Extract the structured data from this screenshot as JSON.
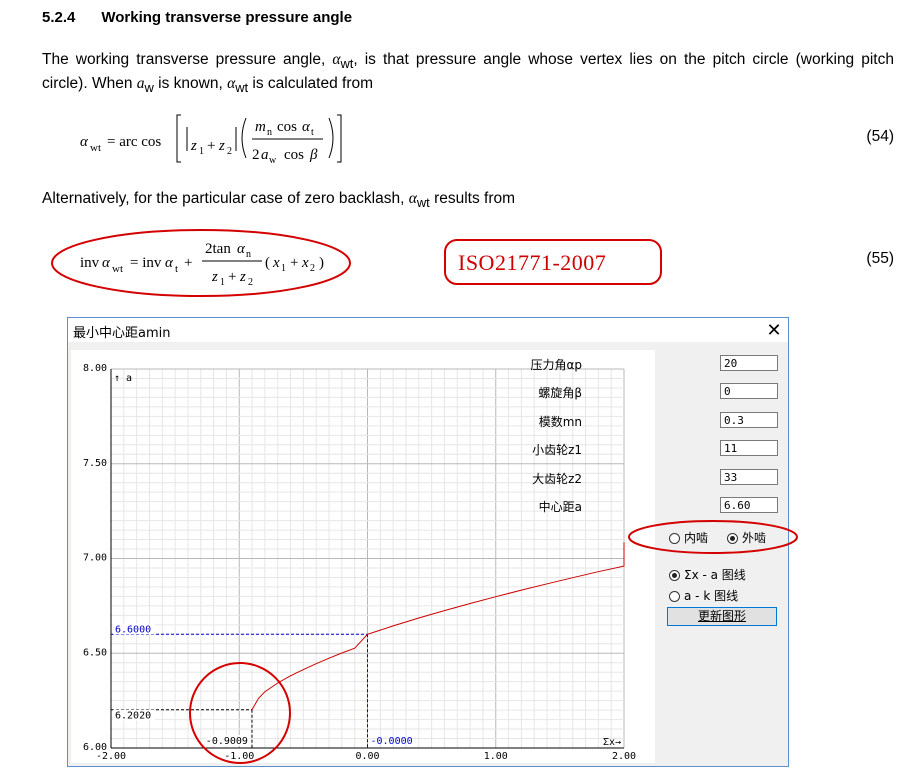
{
  "section": {
    "number": "5.2.4",
    "title": "Working transverse pressure angle"
  },
  "para1": {
    "t1": "The working transverse pressure angle, ",
    "sym1": "α",
    "sub1": "wt",
    "t2": ", is that pressure angle whose vertex lies on the pitch circle (working pitch circle). When ",
    "sym2": "a",
    "sub2": "w",
    "t3": " is known, ",
    "sym3": "α",
    "sub3": "wt",
    "t4": " is calculated from"
  },
  "eq54": {
    "number": "(54)"
  },
  "para2": {
    "t1": "Alternatively, for the particular case of zero backlash, ",
    "sym": "α",
    "sub": "wt",
    "t2": " results from"
  },
  "eq55": {
    "number": "(55)"
  },
  "annotation": {
    "iso": "ISO21771-2007",
    "color": "#d40000"
  },
  "dialog": {
    "title": "最小中心距amin",
    "close": "✕",
    "fields": [
      {
        "label": "压力角αp",
        "value": "20"
      },
      {
        "label": "螺旋角β",
        "value": "0"
      },
      {
        "label": "模数mn",
        "value": "0.3"
      },
      {
        "label": "小齿轮z1",
        "value": "11"
      },
      {
        "label": "大齿轮z2",
        "value": "33"
      },
      {
        "label": "中心距a",
        "value": "6.60"
      }
    ],
    "gear_type": {
      "options": [
        "内啮",
        "外啮"
      ],
      "selected": "外啮"
    },
    "graph_type": {
      "options": [
        "Σx - a 图线",
        "a - k 图线"
      ],
      "selected": "Σx - a 图线"
    },
    "update_button": "更新图形"
  },
  "chart_data": {
    "type": "line",
    "series": [
      {
        "points": [
          [
            -0.9009,
            6.202
          ],
          [
            -0.85,
            6.262
          ],
          [
            -0.8,
            6.2973
          ],
          [
            -0.7,
            6.3429
          ],
          [
            -0.6,
            6.381
          ],
          [
            -0.5,
            6.4139
          ],
          [
            -0.4,
            6.4449
          ],
          [
            -0.3,
            6.4741
          ],
          [
            -0.2,
            6.5011
          ],
          [
            -0.1,
            6.5268
          ],
          [
            0,
            6.6
          ],
          [
            0.2,
            6.6444
          ],
          [
            0.4,
            6.686
          ],
          [
            0.6,
            6.7252
          ],
          [
            0.8,
            6.7626
          ],
          [
            1.0,
            6.7985
          ],
          [
            1.2,
            6.8331
          ],
          [
            1.4,
            6.8665
          ],
          [
            1.6,
            6.8988
          ],
          [
            1.8,
            6.9302
          ],
          [
            2.0,
            6.96
          ],
          [
            2.0,
            7.085
          ]
        ]
      }
    ],
    "xlim": [
      -2.0,
      2.0
    ],
    "ylim": [
      6.0,
      8.0
    ],
    "x_ticks": [
      "-2.00",
      "-1.00",
      "0.00",
      "1.00",
      "2.00"
    ],
    "y_ticks": [
      "6.00",
      "6.50",
      "7.00",
      "7.50",
      "8.00"
    ],
    "xlabel": "Σx→",
    "ylabel": "↑ a",
    "annotations": {
      "a_min": "6.2020",
      "x_min": "-0.9009",
      "a_current": "6.6000",
      "x_current": "-0.0000"
    },
    "grid": true,
    "curve_color": "#cc0000",
    "guide_color": "#0000cc"
  }
}
